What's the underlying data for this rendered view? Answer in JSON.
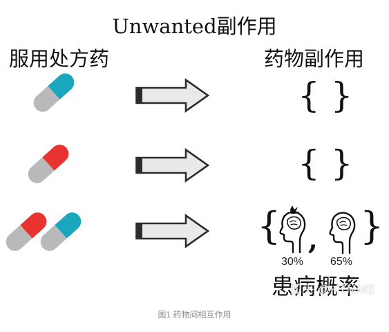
{
  "title": "Unwanted副作用",
  "left_heading": "服用处方药",
  "right_heading": "药物副作用",
  "rows": [
    {
      "pills": [
        {
          "cap_color": "#1aa7be"
        }
      ],
      "effects": "{ }"
    },
    {
      "pills": [
        {
          "cap_color": "#e8332e"
        }
      ],
      "effects": "{ }"
    },
    {
      "pills": [
        {
          "cap_color": "#e8332e"
        },
        {
          "cap_color": "#1aa7be"
        }
      ],
      "effects_left_brace": "{",
      "effects_right_brace": "}",
      "effects_separator": ",",
      "effect_items": [
        {
          "icon": "head-with-headache-icon",
          "probability": "30%"
        },
        {
          "icon": "head-with-brain-icon",
          "probability": "65%"
        }
      ]
    }
  ],
  "footer_label": "患病概率",
  "watermark": "知乎 @HTMME",
  "caption": "图1 药物间相互作用",
  "colors": {
    "pill_body": "#b9b9b9",
    "arrow_fill": "#e9e9ea",
    "arrow_stroke": "#2c2c2c",
    "text": "#111111"
  }
}
